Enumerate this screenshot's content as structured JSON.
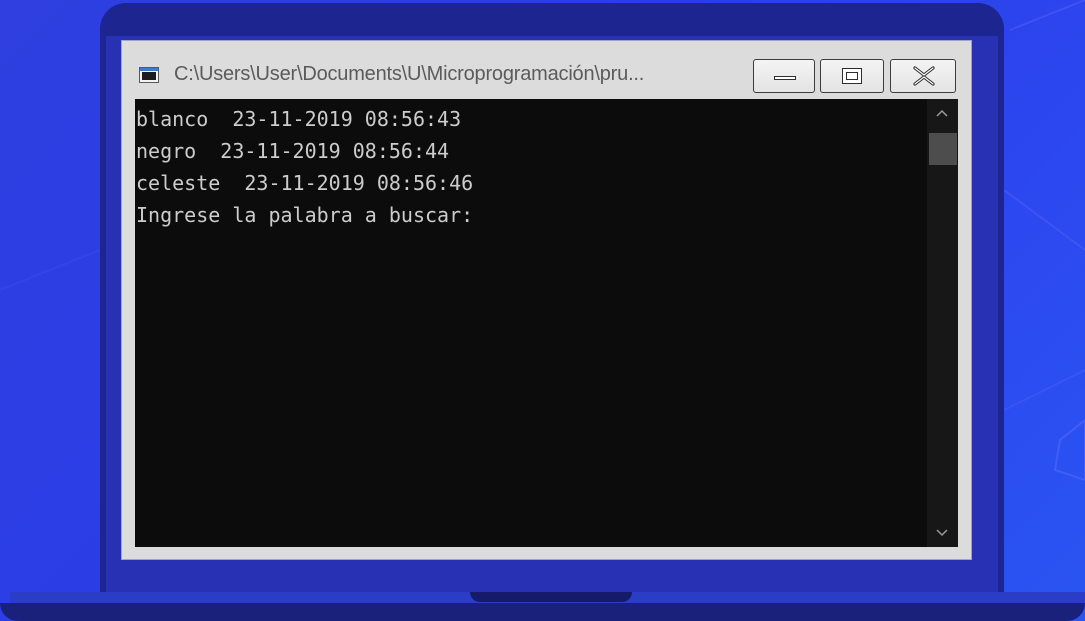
{
  "window": {
    "title": "C:\\Users\\User\\Documents\\U\\Microprogramación\\pru...",
    "buttons": {
      "minimize": "minimize",
      "maximize": "maximize",
      "close": "close"
    }
  },
  "console": {
    "lines": [
      "blanco  23-11-2019 08:56:43",
      "negro  23-11-2019 08:56:44",
      "celeste  23-11-2019 08:56:46",
      "Ingrese la palabra a buscar:"
    ]
  },
  "icons": {
    "app": "console-app-icon",
    "minimize": "minimize-icon",
    "maximize": "maximize-icon",
    "close": "close-icon",
    "scroll_up": "chevron-up-icon",
    "scroll_down": "chevron-down-icon"
  },
  "colors": {
    "background": "#2c43ea",
    "console_bg": "#0c0c0c",
    "console_text": "#cccccc",
    "titlebar": "#dcdcdc"
  }
}
